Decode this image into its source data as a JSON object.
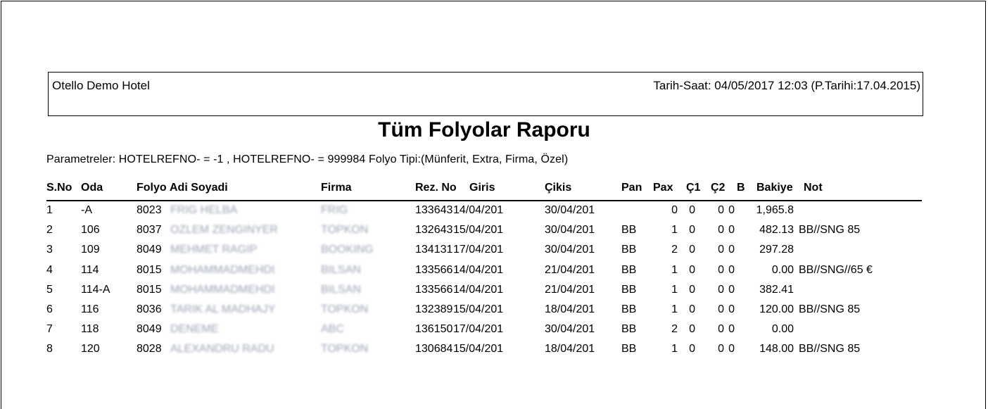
{
  "report": {
    "hotel_name": "Otello Demo Hotel",
    "datetime": "Tarih-Saat: 04/05/2017 12:03 (P.Tarihi:17.04.2015)",
    "title": "Tüm Folyolar Raporu",
    "parameters": "Parametreler: HOTELREFNO- = -1 , HOTELREFNO- = 999984  Folyo Tipi:(Münferit,  Extra,  Firma,  Özel)"
  },
  "table": {
    "headers": {
      "sno": "S.No",
      "oda": "Oda",
      "folyo": "Folyo",
      "adi": "Adi Soyadi",
      "firma": "Firma",
      "rez": "Rez. No",
      "giris": "Giris",
      "cikis": "Çikis",
      "pan": "Pan",
      "pax": "Pax",
      "c1": "Ç1",
      "c2": "Ç2",
      "b": "B",
      "bakiye": "Bakiye",
      "not": "Not"
    },
    "rows": [
      {
        "sno": "1",
        "oda": "-A",
        "folyo": "8023",
        "adi": "FRIG HELBA",
        "firma": "FRIG",
        "rez": "133643",
        "giris": "14/04/201",
        "cikis": "30/04/201",
        "pan": "",
        "pax": "0",
        "c1": "0",
        "c2": "0",
        "b": "0",
        "bakiye": "1,965.8",
        "not": ""
      },
      {
        "sno": "2",
        "oda": "106",
        "folyo": "8037",
        "adi": "OZLEM ZENGINYER",
        "firma": "TOPKON",
        "rez": "132643",
        "giris": "15/04/201",
        "cikis": "30/04/201",
        "pan": "BB",
        "pax": "1",
        "c1": "0",
        "c2": "0",
        "b": "0",
        "bakiye": "482.13",
        "not": "BB//SNG 85"
      },
      {
        "sno": "3",
        "oda": "109",
        "folyo": "8049",
        "adi": "MEHMET RAGIP",
        "firma": "BOOKING",
        "rez": "134131",
        "giris": "17/04/201",
        "cikis": "30/04/201",
        "pan": "BB",
        "pax": "2",
        "c1": "0",
        "c2": "0",
        "b": "0",
        "bakiye": "297.28",
        "not": ""
      },
      {
        "sno": "4",
        "oda": "114",
        "folyo": "8015",
        "adi": "MOHAMMADMEHDI",
        "firma": "BILSAN",
        "rez": "133566",
        "giris": "14/04/201",
        "cikis": "21/04/201",
        "pan": "BB",
        "pax": "1",
        "c1": "0",
        "c2": "0",
        "b": "0",
        "bakiye": "0.00",
        "not": "BB//SNG//65 €"
      },
      {
        "sno": "5",
        "oda": "114-A",
        "folyo": "8015",
        "adi": "MOHAMMADMEHDI",
        "firma": "BILSAN",
        "rez": "133566",
        "giris": "14/04/201",
        "cikis": "21/04/201",
        "pan": "BB",
        "pax": "1",
        "c1": "0",
        "c2": "0",
        "b": "0",
        "bakiye": "382.41",
        "not": ""
      },
      {
        "sno": "6",
        "oda": "116",
        "folyo": "8036",
        "adi": "TARIK AL MADHAJY",
        "firma": "TOPKON",
        "rez": "132389",
        "giris": "15/04/201",
        "cikis": "18/04/201",
        "pan": "BB",
        "pax": "1",
        "c1": "0",
        "c2": "0",
        "b": "0",
        "bakiye": "120.00",
        "not": "BB//SNG 85"
      },
      {
        "sno": "7",
        "oda": "118",
        "folyo": "8049",
        "adi": "DENEME",
        "firma": "ABC",
        "rez": "136150",
        "giris": "17/04/201",
        "cikis": "30/04/201",
        "pan": "BB",
        "pax": "2",
        "c1": "0",
        "c2": "0",
        "b": "0",
        "bakiye": "0.00",
        "not": ""
      },
      {
        "sno": "8",
        "oda": "120",
        "folyo": "8028",
        "adi": "ALEXANDRU RADU",
        "firma": "TOPKON",
        "rez": "130684",
        "giris": "15/04/201",
        "cikis": "18/04/201",
        "pan": "BB",
        "pax": "1",
        "c1": "0",
        "c2": "0",
        "b": "0",
        "bakiye": "148.00",
        "not": "BB//SNG 85"
      }
    ]
  }
}
